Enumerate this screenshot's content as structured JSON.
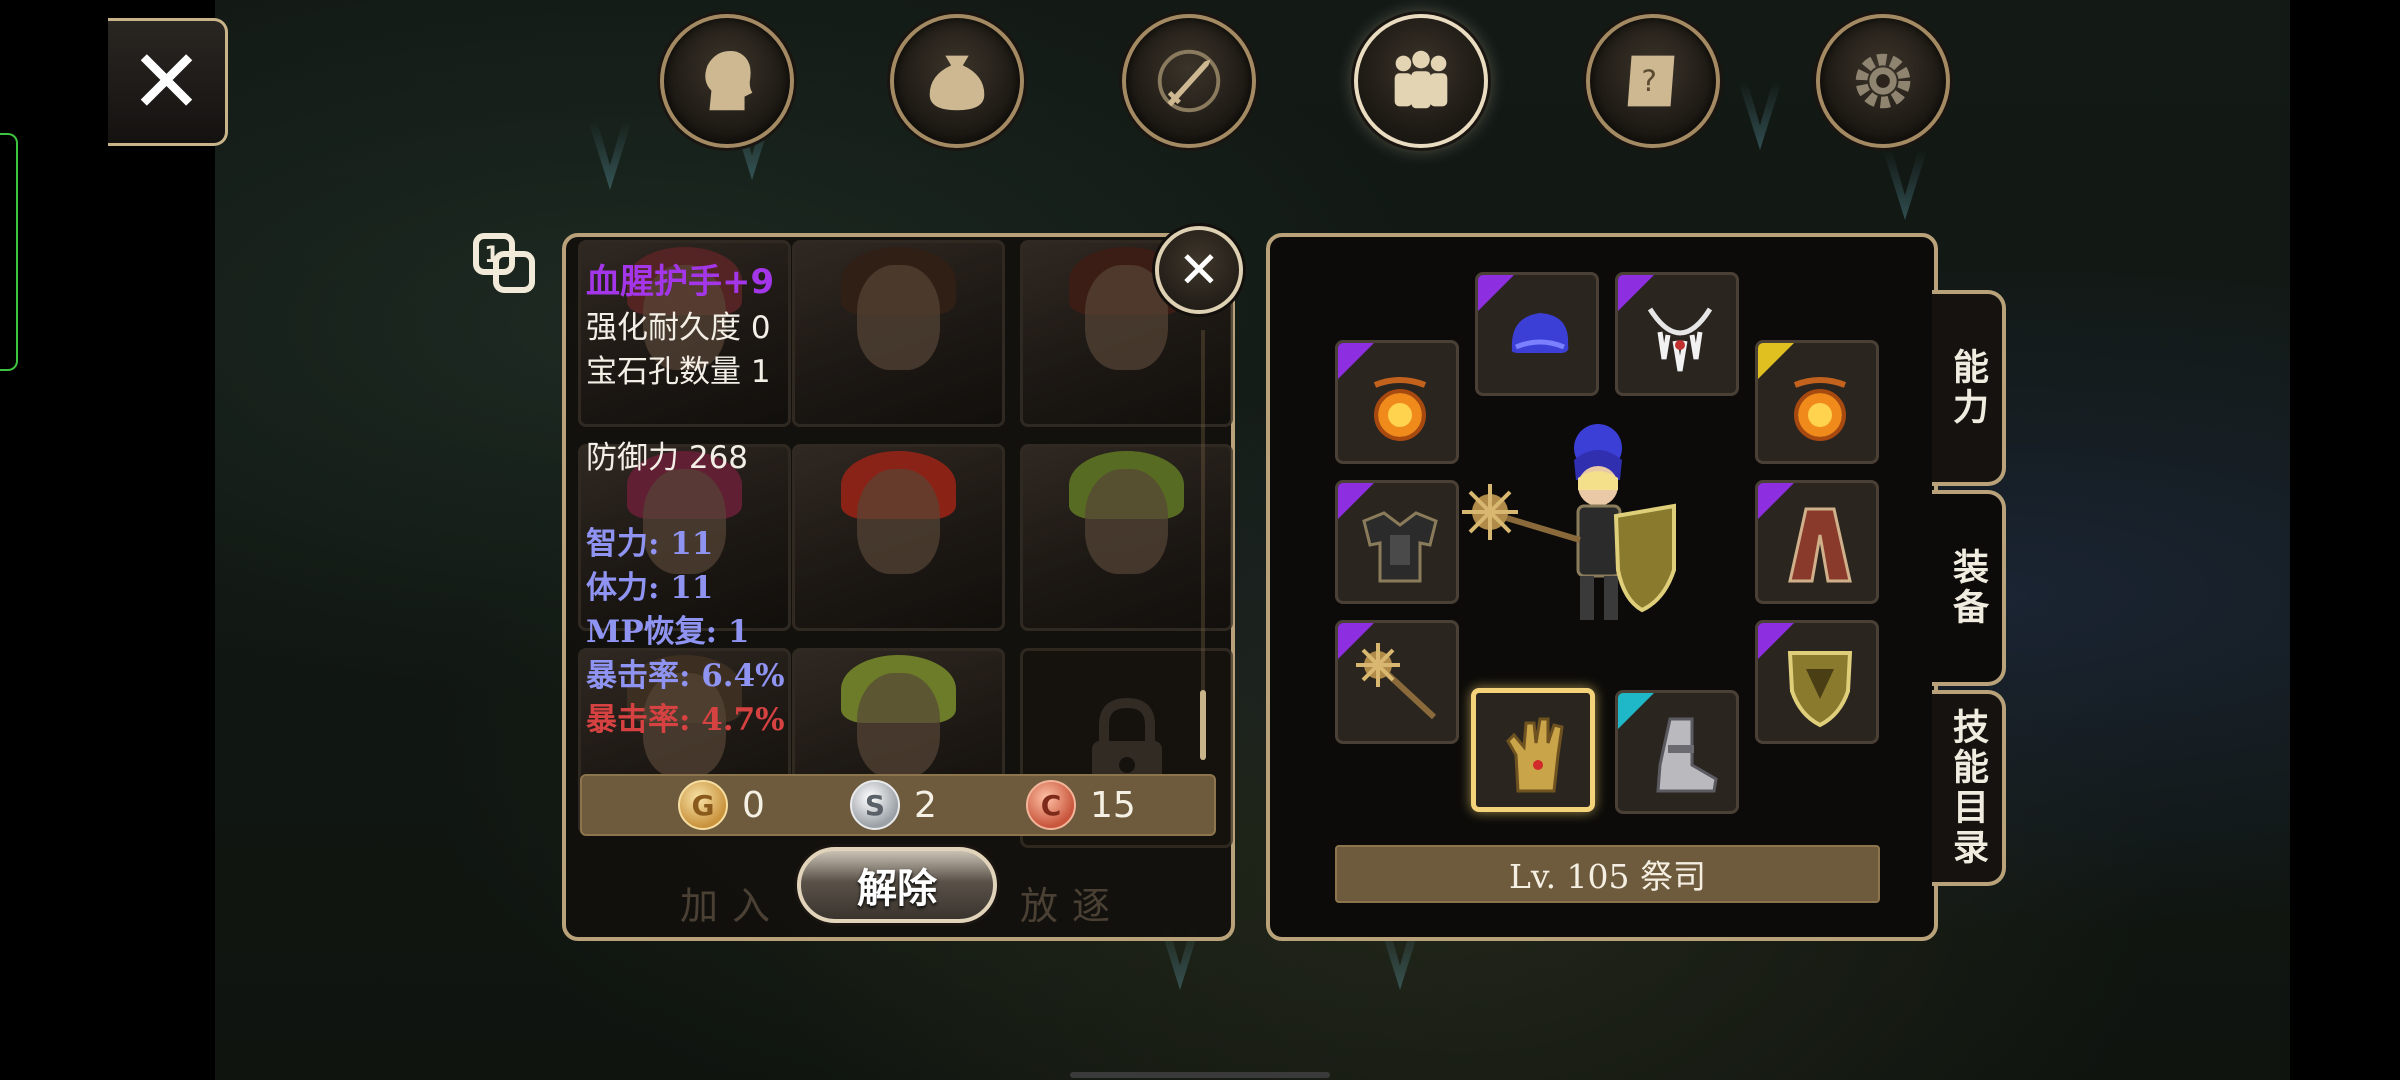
{
  "top_nav": {
    "close_icon": "close-x-icon",
    "buttons": [
      {
        "icon": "profile-head-icon",
        "active": false
      },
      {
        "icon": "inventory-bag-icon",
        "active": false
      },
      {
        "icon": "combat-sword-icon",
        "active": false
      },
      {
        "icon": "party-members-icon",
        "active": true
      },
      {
        "icon": "quest-scroll-icon",
        "active": false
      },
      {
        "icon": "settings-gear-icon",
        "active": false
      }
    ]
  },
  "item_tooltip": {
    "name": "血腥护手+9",
    "name_color": "#a236e8",
    "lines": [
      "强化耐久度 0",
      "宝石孔数量 1",
      "防御力 268"
    ],
    "stats_blue": [
      "智力: 11",
      "体力: 11",
      "MP恢复: 1",
      "暴击率: 6.4%"
    ],
    "stat_red": "暴击率: 4.7%",
    "currency": {
      "gold": {
        "symbol": "G",
        "value": "0"
      },
      "silver": {
        "symbol": "S",
        "value": "2"
      },
      "copper": {
        "symbol": "C",
        "value": "15"
      }
    }
  },
  "party_actions": {
    "join_label": "加入",
    "release_label": "解除",
    "expel_label": "放逐"
  },
  "equipment": {
    "level_label": "Lv. 105 祭司",
    "slots": [
      {
        "name": "helmet",
        "icon": "blue-cap-icon",
        "rarity": "#8d2ee0"
      },
      {
        "name": "necklace",
        "icon": "fang-necklace-icon",
        "rarity": "#8d2ee0"
      },
      {
        "name": "ring-left",
        "icon": "fire-ring-icon",
        "rarity": "#8d2ee0"
      },
      {
        "name": "ring-right",
        "icon": "fire-ring-icon",
        "rarity": "#e0c020"
      },
      {
        "name": "armor",
        "icon": "dark-armor-icon",
        "rarity": "#8d2ee0"
      },
      {
        "name": "cloak",
        "icon": "red-cloak-icon",
        "rarity": "#8d2ee0"
      },
      {
        "name": "weapon",
        "icon": "spiked-mace-icon",
        "rarity": "#8d2ee0"
      },
      {
        "name": "shield",
        "icon": "golden-shield-icon",
        "rarity": "#8d2ee0"
      },
      {
        "name": "gloves",
        "icon": "gold-gauntlet-icon",
        "rarity": null,
        "selected": true
      },
      {
        "name": "boots",
        "icon": "steel-boots-icon",
        "rarity": "#1fb8c8"
      }
    ]
  },
  "side_tabs": [
    {
      "label": "能力",
      "active": false
    },
    {
      "label": "装备",
      "active": true
    },
    {
      "label": "技能目录",
      "active": false
    }
  ]
}
